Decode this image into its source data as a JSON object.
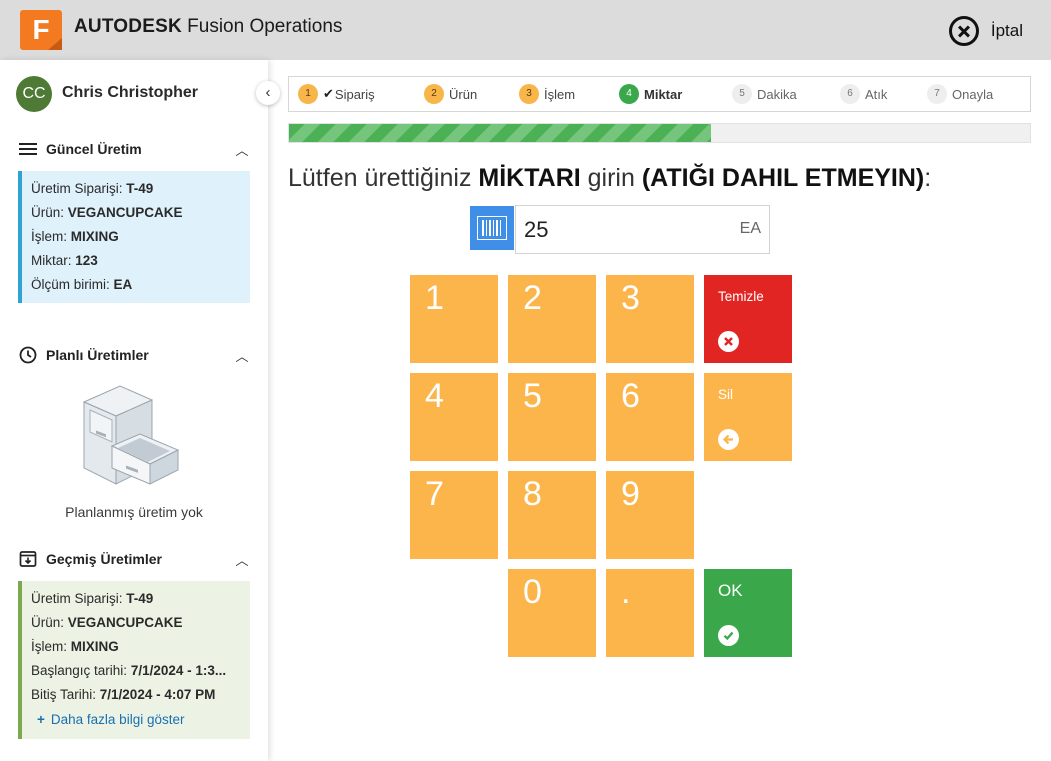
{
  "header": {
    "logo_letter": "F",
    "brand_bold": "AUTODESK",
    "brand_product": "Fusion Operations",
    "cancel_label": "İptal"
  },
  "sidebar": {
    "avatar_initials": "CC",
    "user_name": "Chris Christopher",
    "current": {
      "title": "Güncel Üretim",
      "rows": [
        {
          "k": "Üretim Siparişi: ",
          "v": "T-49"
        },
        {
          "k": "Ürün: ",
          "v": "VEGANCUPCAKE"
        },
        {
          "k": "İşlem: ",
          "v": "MIXING"
        },
        {
          "k": "Miktar: ",
          "v": "123"
        },
        {
          "k": "Ölçüm birimi: ",
          "v": "EA"
        }
      ]
    },
    "planned": {
      "title": "Planlı Üretimler",
      "empty_text": "Planlanmış üretim yok"
    },
    "past": {
      "title": "Geçmiş Üretimler",
      "rows": [
        {
          "k": "Üretim Siparişi: ",
          "v": "T-49"
        },
        {
          "k": "Ürün: ",
          "v": "VEGANCUPCAKE"
        },
        {
          "k": "İşlem: ",
          "v": "MIXING"
        },
        {
          "k": "Başlangıç tarihi: ",
          "v": "7/1/2024 - 1:3..."
        },
        {
          "k": "Bitiş Tarihi: ",
          "v": "7/1/2024 - 4:07 PM"
        }
      ],
      "more_label": "Daha fazla bilgi göster"
    }
  },
  "stepper": {
    "steps": [
      {
        "num": "1",
        "label": "Sipariş",
        "state": "done"
      },
      {
        "num": "2",
        "label": "Ürün",
        "state": "done"
      },
      {
        "num": "3",
        "label": "İşlem",
        "state": "done"
      },
      {
        "num": "4",
        "label": "Miktar",
        "state": "active"
      },
      {
        "num": "5",
        "label": "Dakika",
        "state": "pending"
      },
      {
        "num": "6",
        "label": "Atık",
        "state": "pending"
      },
      {
        "num": "7",
        "label": "Onayla",
        "state": "pending"
      }
    ]
  },
  "progress": {
    "fraction": 0.57
  },
  "prompt": {
    "p1": "Lütfen ürettiğiniz ",
    "p2": "MİKTARI",
    "p3": " girin ",
    "p4": "(ATIĞI DAHIL ETMEYIN)",
    "p5": ":"
  },
  "quantity": {
    "value": "25",
    "unit": "EA"
  },
  "keypad": {
    "digits": [
      "1",
      "2",
      "3",
      "4",
      "5",
      "6",
      "7",
      "8",
      "9",
      "0",
      "."
    ],
    "clear_label": "Temizle",
    "delete_label": "Sil",
    "ok_label": "OK"
  },
  "colors": {
    "key": "#fbb54b",
    "clear": "#e02523",
    "ok": "#3aa84a",
    "accent_blue": "#3f8fe8",
    "brand_orange": "#f37a20"
  }
}
